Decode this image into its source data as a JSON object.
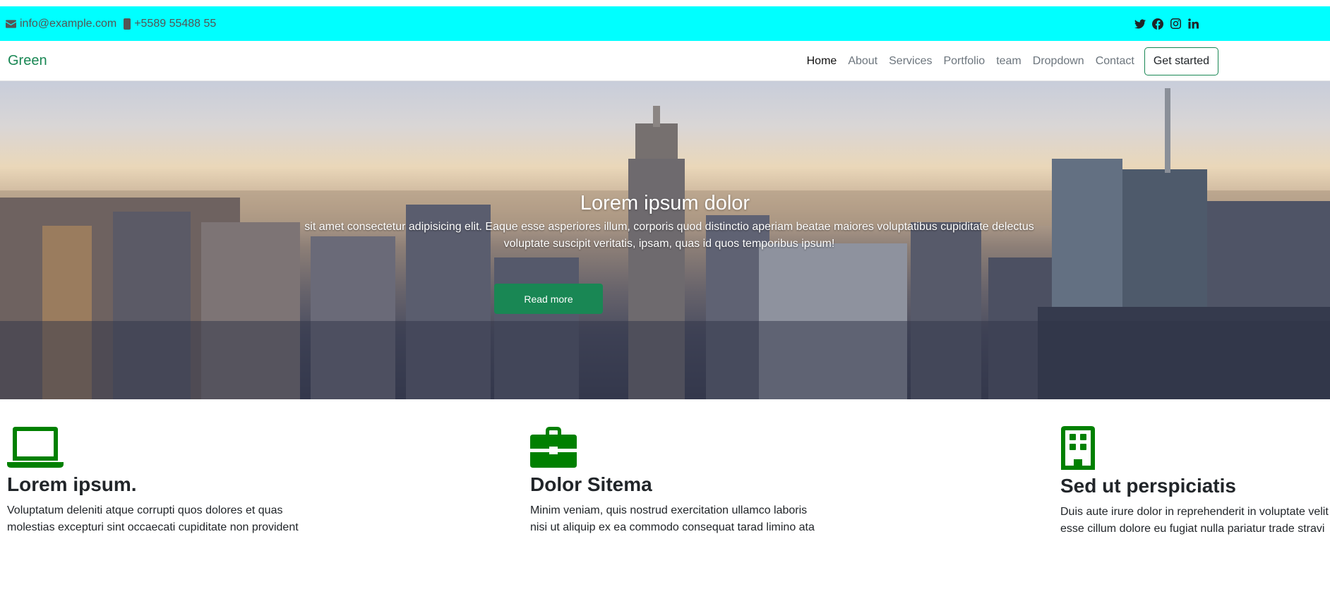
{
  "topbar": {
    "email": "info@example.com",
    "phone": "+5589 55488 55",
    "icons": [
      "envelope-icon",
      "phone-icon",
      "twitter-icon",
      "facebook-icon",
      "instagram-icon",
      "linkedin-icon"
    ],
    "background": "#00ffff"
  },
  "navbar": {
    "brand": "Green",
    "links": [
      "Home",
      "About",
      "Services",
      "Portfolio",
      "team",
      "Dropdown",
      "Contact"
    ],
    "active": "Home",
    "cta": "Get started"
  },
  "hero": {
    "title": "Lorem ipsum dolor",
    "text": "sit amet consectetur adipisicing elit. Eaque esse asperiores illum, corporis quod distinctio aperiam beatae maiores voluptatibus cupiditate delectus voluptate suscipit veritatis, ipsam, quas id quos temporibus ipsum!",
    "button": "Read more",
    "background": "city skyline photo"
  },
  "features": [
    {
      "icon": "laptop-icon",
      "title": "Lorem ipsum.",
      "text": "Voluptatum deleniti atque corrupti quos dolores et quas molestias excepturi sint occaecati cupiditate non provident"
    },
    {
      "icon": "briefcase-icon",
      "title": "Dolor Sitema",
      "text": "Minim veniam, quis nostrud exercitation ullamco laboris nisi ut aliquip ex ea commodo consequat tarad limino ata"
    },
    {
      "icon": "building-icon",
      "title": "Sed ut perspiciatis",
      "text": "Duis aute irure dolor in reprehenderit in voluptate velit esse cillum dolore eu fugiat nulla pariatur trade stravi"
    }
  ],
  "colors": {
    "accent": "#198754",
    "icon_green": "#008000",
    "topbar": "#00ffff"
  }
}
